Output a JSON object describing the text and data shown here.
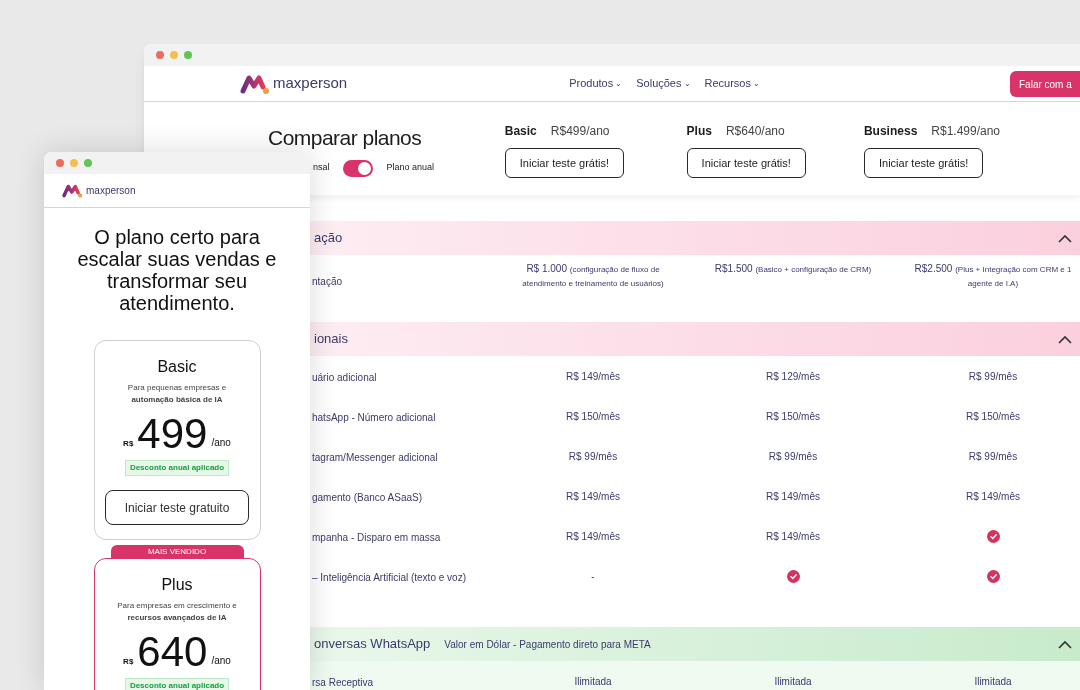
{
  "desktop_window": {
    "logo": "maxperson",
    "nav": [
      {
        "label": "Produtos",
        "caret": "⌄"
      },
      {
        "label": "Soluções",
        "caret": "⌄"
      },
      {
        "label": "Recursos",
        "caret": "⌄"
      }
    ],
    "cta": "Falar com a",
    "compare": {
      "title": "Comparar planos",
      "toggle": {
        "left_label": "nsal",
        "right_label": "Plano anual",
        "on": true
      },
      "plans": [
        {
          "name": "Basic",
          "price": "R$499/ano",
          "button": "Iniciar teste grátis!"
        },
        {
          "name": "Plus",
          "price": "R$640/ano",
          "button": "Iniciar teste grátis!"
        },
        {
          "name": "Business",
          "price": "R$1.499/ano",
          "button": "Iniciar teste grátis!"
        }
      ]
    },
    "sections": [
      {
        "title": "ação",
        "color": "#fbd0de",
        "expanded": true,
        "rows": [
          {
            "label": "ntação",
            "cells": [
              {
                "kind": "text",
                "main": "R$ 1.000",
                "note": "(configuração de fluxo de atendimento e treinamento de usuários)"
              },
              {
                "kind": "text",
                "main": "R$1.500",
                "note": "(Basico + configuração de CRM)"
              },
              {
                "kind": "text",
                "main": "R$2.500",
                "note": "(Plus + Integração com CRM e 1 agente de I.A)"
              }
            ]
          }
        ]
      },
      {
        "title": "ionais",
        "color": "#fbd0de",
        "expanded": true,
        "rows": [
          {
            "label": "uário adicional",
            "cells": [
              {
                "kind": "text",
                "main": "R$ 149/mês"
              },
              {
                "kind": "text",
                "main": "R$ 129/mês"
              },
              {
                "kind": "text",
                "main": "R$ 99/mês"
              }
            ]
          },
          {
            "label": "hatsApp - Número adicional",
            "cells": [
              {
                "kind": "text",
                "main": "R$ 150/mês"
              },
              {
                "kind": "text",
                "main": "R$ 150/mês"
              },
              {
                "kind": "text",
                "main": "R$ 150/mês"
              }
            ]
          },
          {
            "label": "tagram/Messenger adicional",
            "cells": [
              {
                "kind": "text",
                "main": "R$ 99/mês"
              },
              {
                "kind": "text",
                "main": "R$ 99/mês"
              },
              {
                "kind": "text",
                "main": "R$ 99/mês"
              }
            ]
          },
          {
            "label": "gamento (Banco ASaaS)",
            "cells": [
              {
                "kind": "text",
                "main": "R$ 149/mês"
              },
              {
                "kind": "text",
                "main": "R$ 149/mês"
              },
              {
                "kind": "text",
                "main": "R$ 149/mês"
              }
            ]
          },
          {
            "label": "mpanha - Disparo em massa",
            "cells": [
              {
                "kind": "text",
                "main": "R$ 149/mês"
              },
              {
                "kind": "text",
                "main": "R$ 149/mês"
              },
              {
                "kind": "check"
              }
            ]
          },
          {
            "label": "– Inteligência Artificial (texto e voz)",
            "cells": [
              {
                "kind": "text",
                "main": "-"
              },
              {
                "kind": "check"
              },
              {
                "kind": "check"
              }
            ]
          }
        ]
      },
      {
        "title": "onversas WhatsApp",
        "subtitle": "Valor em Dólar - Pagamento direto para META",
        "color": "#c8ebcc",
        "expanded": true,
        "rows": [
          {
            "label": "rsa Receptiva",
            "cells": [
              {
                "kind": "text",
                "main": "Ilimitada"
              },
              {
                "kind": "text",
                "main": "Ilimitada"
              },
              {
                "kind": "text",
                "main": "Ilimitada"
              }
            ]
          }
        ]
      }
    ]
  },
  "mobile_window": {
    "logo": "maxperson",
    "headline": "O plano certo para escalar suas vendas e transformar seu atendimento.",
    "cards": [
      {
        "name": "Basic",
        "description": "Para pequenas empresas e **automação básica de IA**",
        "currency": "R$",
        "price": "499",
        "period": "/ano",
        "discount": "Desconto anual aplicado",
        "button": "Iniciar teste gratuito",
        "featured": false
      },
      {
        "name": "Plus",
        "badge": "MAIS VENDIDO",
        "description": "Para empresas em crescimento e **recursos avançados de IA**",
        "currency": "R$",
        "price": "640",
        "period": "/ano",
        "discount": "Desconto anual aplicado",
        "featured": true
      }
    ]
  }
}
